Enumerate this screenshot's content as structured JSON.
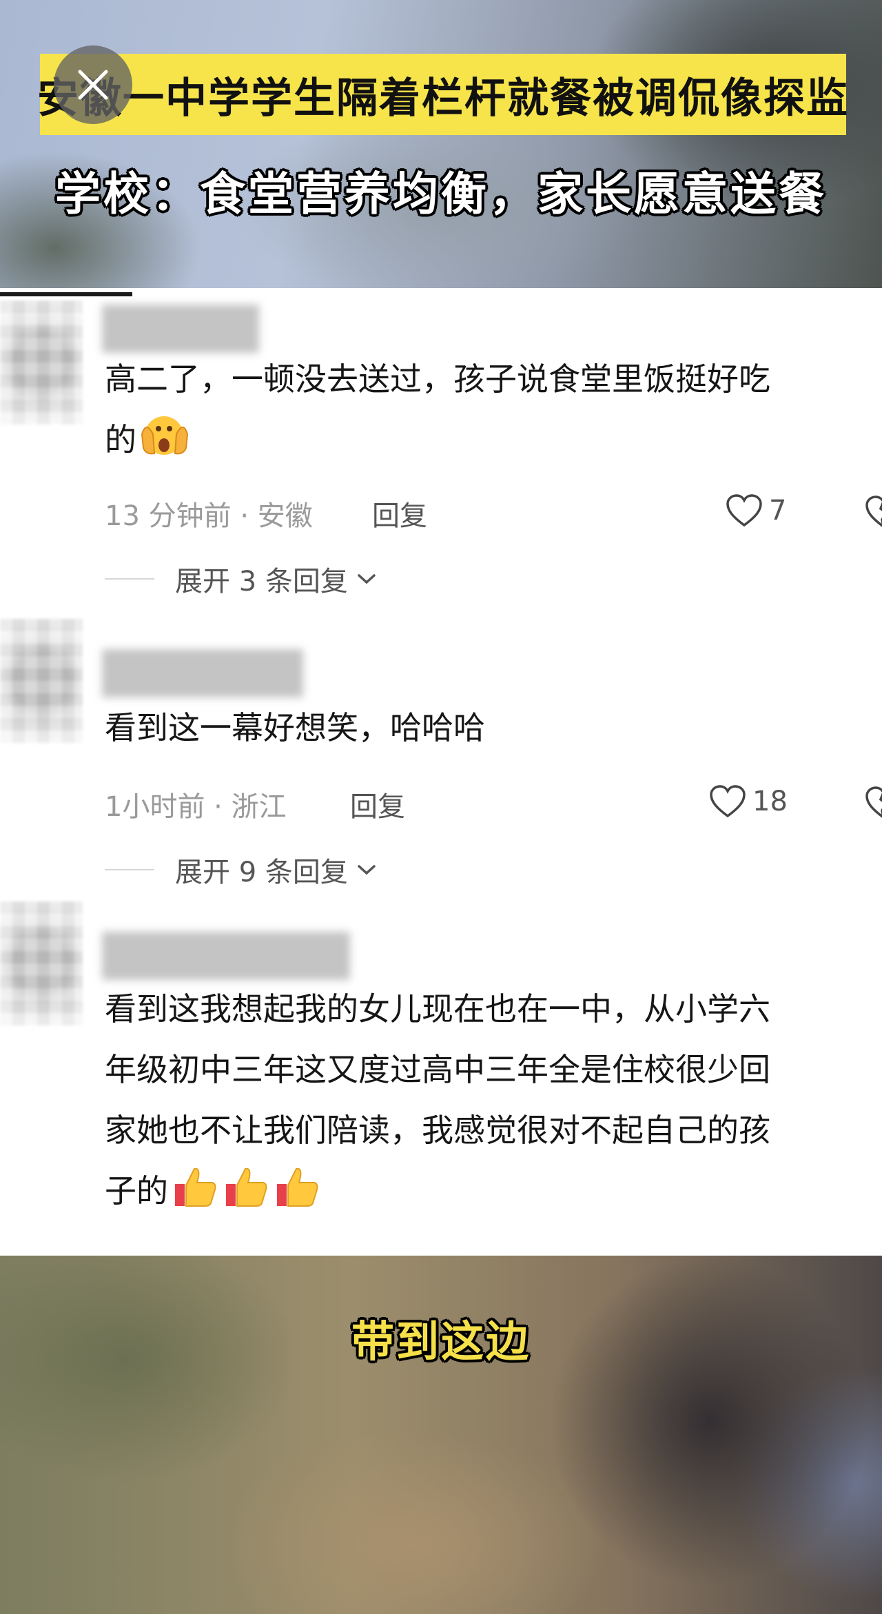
{
  "video": {
    "banner_title": "安徽一中学学生隔着栏杆就餐被调侃像探监",
    "subtitle": "学校：食堂营养均衡，家长愿意送餐",
    "bottom_caption": "带到这边"
  },
  "comments": [
    {
      "text_line1": "高二了，一顿没去送过，孩子说食堂里饭挺好吃",
      "text_line2": "的",
      "emoji": "face-with-hands-over-cheeks-icon",
      "time_location": "13 分钟前 · 安徽",
      "reply_label": "回复",
      "likes": "7",
      "expand_label": "展开 3 条回复"
    },
    {
      "text_line1": "看到这一幕好想笑，哈哈哈",
      "time_location": "1小时前 · 浙江",
      "reply_label": "回复",
      "likes": "18",
      "expand_label": "展开 9 条回复"
    },
    {
      "text_line1": "看到这我想起我的女儿现在也在一中，从小学六",
      "text_line2": "年级初中三年这又度过高中三年全是住校很少回",
      "text_line3": "家她也不让我们陪读，我感觉很对不起自己的孩",
      "text_line4": "子的",
      "emoji": "thumbs-up-icon"
    }
  ],
  "colors": {
    "banner_bg": "#f6e44a",
    "caption_yellow": "#f5e04a",
    "meta_gray": "#9a9a9a"
  }
}
